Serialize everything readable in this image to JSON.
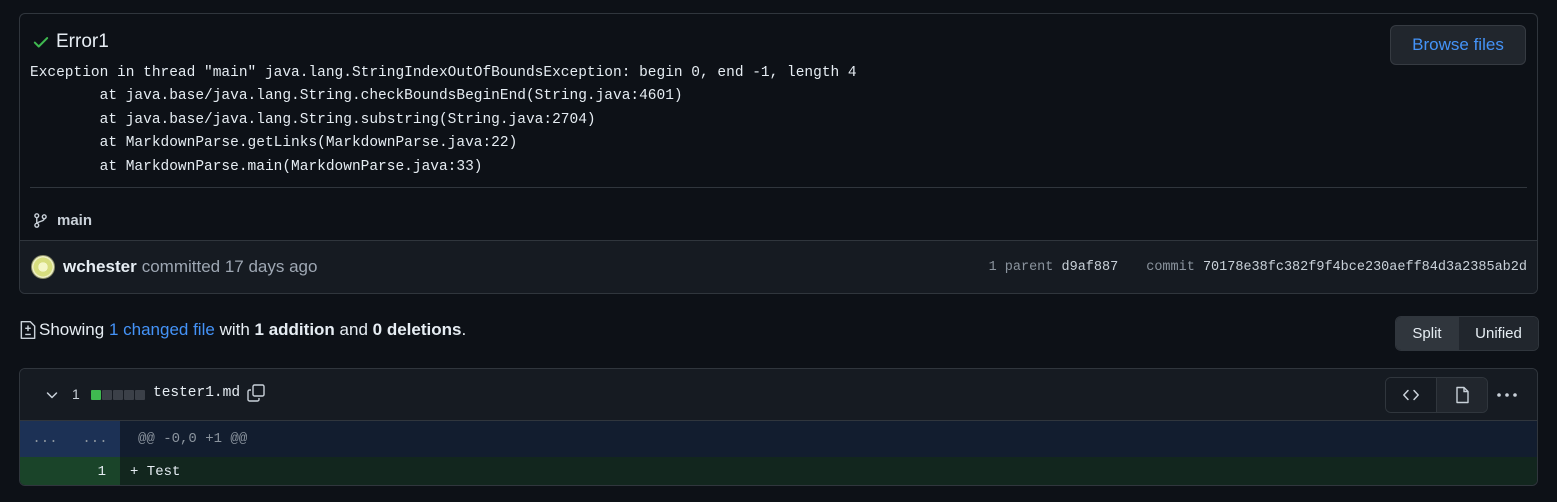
{
  "commit": {
    "title": "Error1",
    "browse_label": "Browse files",
    "message": "Exception in thread \"main\" java.lang.StringIndexOutOfBoundsException: begin 0, end -1, length 4\n        at java.base/java.lang.String.checkBoundsBeginEnd(String.java:4601)\n        at java.base/java.lang.String.substring(String.java:2704)\n        at MarkdownParse.getLinks(MarkdownParse.java:22)\n        at MarkdownParse.main(MarkdownParse.java:33)",
    "branch": "main",
    "author": "wchester",
    "committed_text": "committed 17 days ago",
    "parent_label": "1 parent",
    "parent_sha": "d9af887",
    "commit_label": "commit",
    "commit_sha": "70178e38fc382f9f4bce230aeff84d3a2385ab2d"
  },
  "summary": {
    "prefix": "Showing",
    "changed_files": "1 changed file",
    "with": "with",
    "additions": "1 addition",
    "and": "and",
    "deletions": "0 deletions",
    "period": "."
  },
  "view_toggle": {
    "split_label": "Split",
    "unified_label": "Unified",
    "selected": "Split"
  },
  "file": {
    "change_count": "1",
    "name": "tester1.md",
    "diffstat": [
      "added",
      "neutral",
      "neutral",
      "neutral",
      "neutral"
    ],
    "hunk": {
      "expander_old": "...",
      "expander_new": "...",
      "header": "@@ -0,0 +1 @@"
    },
    "lines": [
      {
        "old_num": "",
        "new_num": "1",
        "content": "+ Test",
        "type": "addition"
      }
    ]
  },
  "colors": {
    "accent": "#4493f8",
    "success": "#3fb950",
    "background": "#0d1117"
  },
  "icons": [
    "check-icon",
    "git-branch-icon",
    "file-diff-icon",
    "chevron-down-icon",
    "copy-icon",
    "code-icon",
    "file-icon",
    "kebab-horizontal-icon"
  ]
}
